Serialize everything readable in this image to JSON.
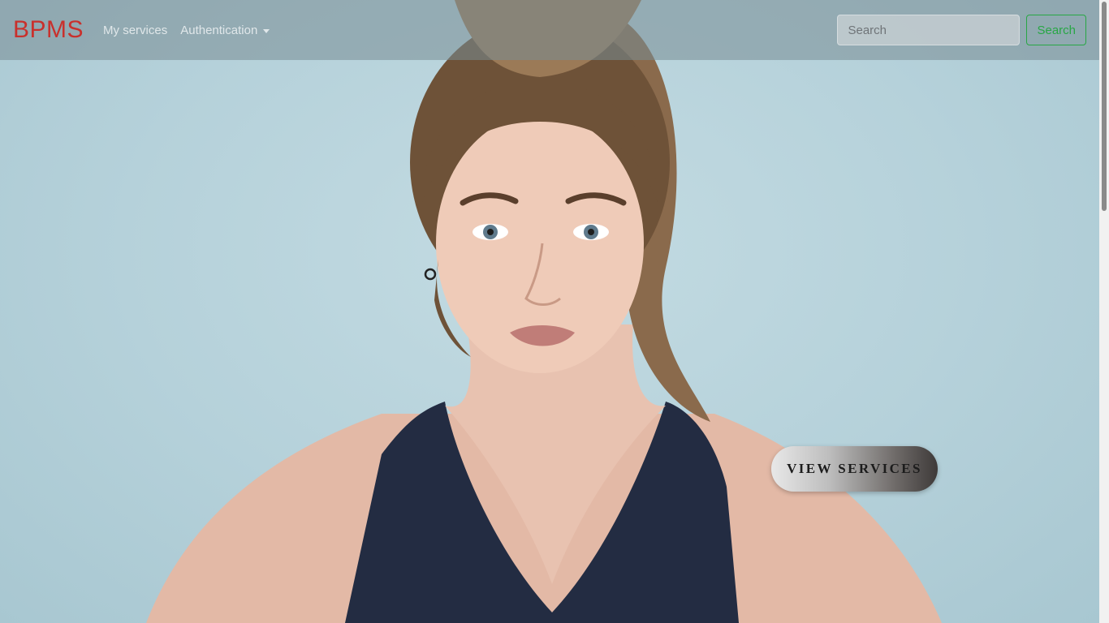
{
  "navbar": {
    "brand": "BPMS",
    "links": [
      {
        "label": "My services"
      },
      {
        "label": "Authentication"
      }
    ],
    "search": {
      "placeholder": "Search",
      "value": "",
      "button_label": "Search"
    }
  },
  "hero": {
    "image": "model-portrait-photo",
    "cta_label": "VIEW SERVICES"
  },
  "colors": {
    "brand": "#c9302c",
    "search_button": "#28a745",
    "hero_background": "#b8d4dc"
  }
}
